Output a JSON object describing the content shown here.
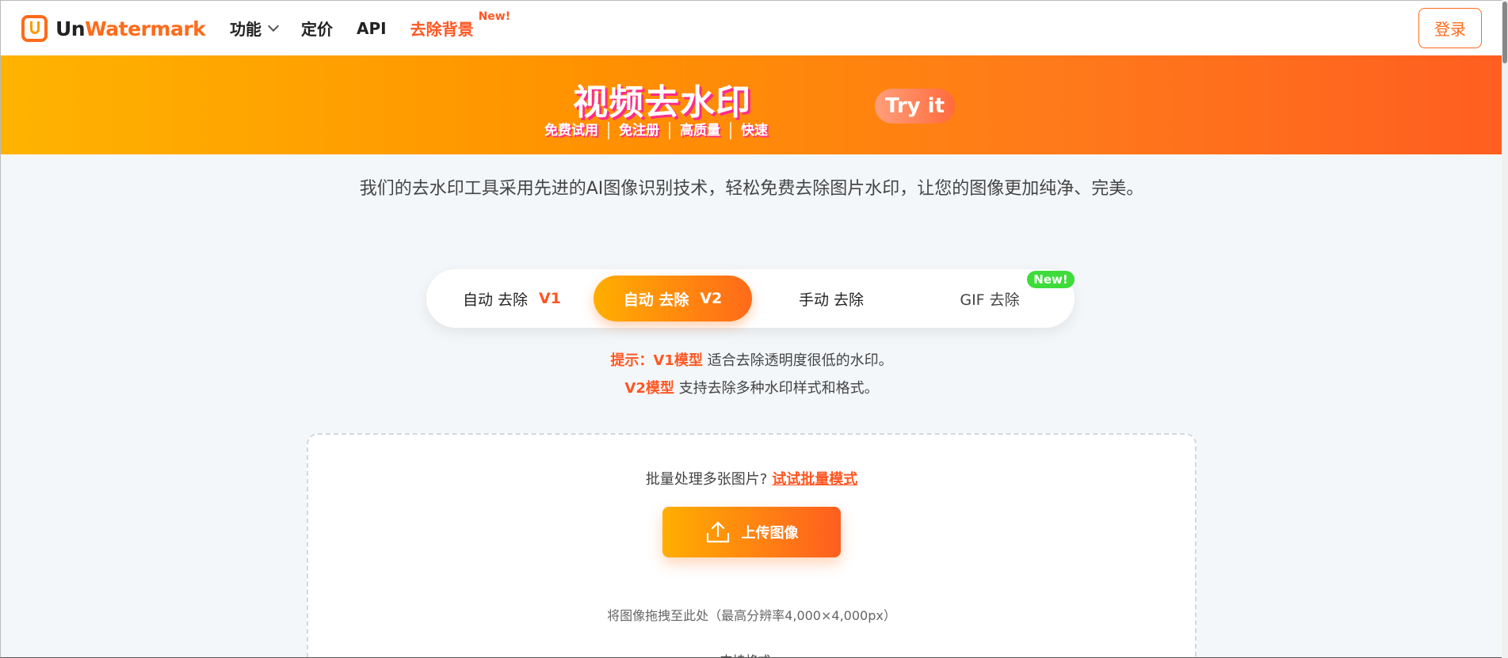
{
  "header": {
    "logo_un": "Un",
    "logo_wm": "Watermark",
    "nav": {
      "features": "功能",
      "pricing": "定价",
      "api": "API",
      "remove_bg": "去除背景",
      "remove_bg_badge": "New!"
    },
    "login": "登录"
  },
  "banner": {
    "title": "视频去水印",
    "tags": [
      "免费试用",
      "免注册",
      "高质量",
      "快速"
    ],
    "try_it": "Try it"
  },
  "intro": "我们的去水印工具采用先进的AI图像识别技术，轻松免费去除图片水印，让您的图像更加纯净、完美。",
  "tabs": {
    "auto_v1": {
      "label": "自动 去除",
      "ver": "V1"
    },
    "auto_v2": {
      "label": "自动 去除",
      "ver": "V2"
    },
    "manual": "手动 去除",
    "gif": "GIF 去除",
    "gif_badge": "New!",
    "active": "auto_v2"
  },
  "hints": {
    "line1_prefix": "提示：V1模型",
    "line1_text": " 适合去除透明度很低的水印。",
    "line2_prefix": "V2模型",
    "line2_text": " 支持去除多种水印样式和格式。"
  },
  "upload": {
    "batch_text": "批量处理多张图片?",
    "batch_link": "试试批量模式",
    "button": "上传图像",
    "drop_text": "将图像拖拽至此处（最高分辨率4,000×4,000px）",
    "formats_label": "支持格式："
  },
  "colors": {
    "accent": "#ff6b1a",
    "highlight": "#ff5722",
    "new_badge": "#3ddc3a"
  }
}
